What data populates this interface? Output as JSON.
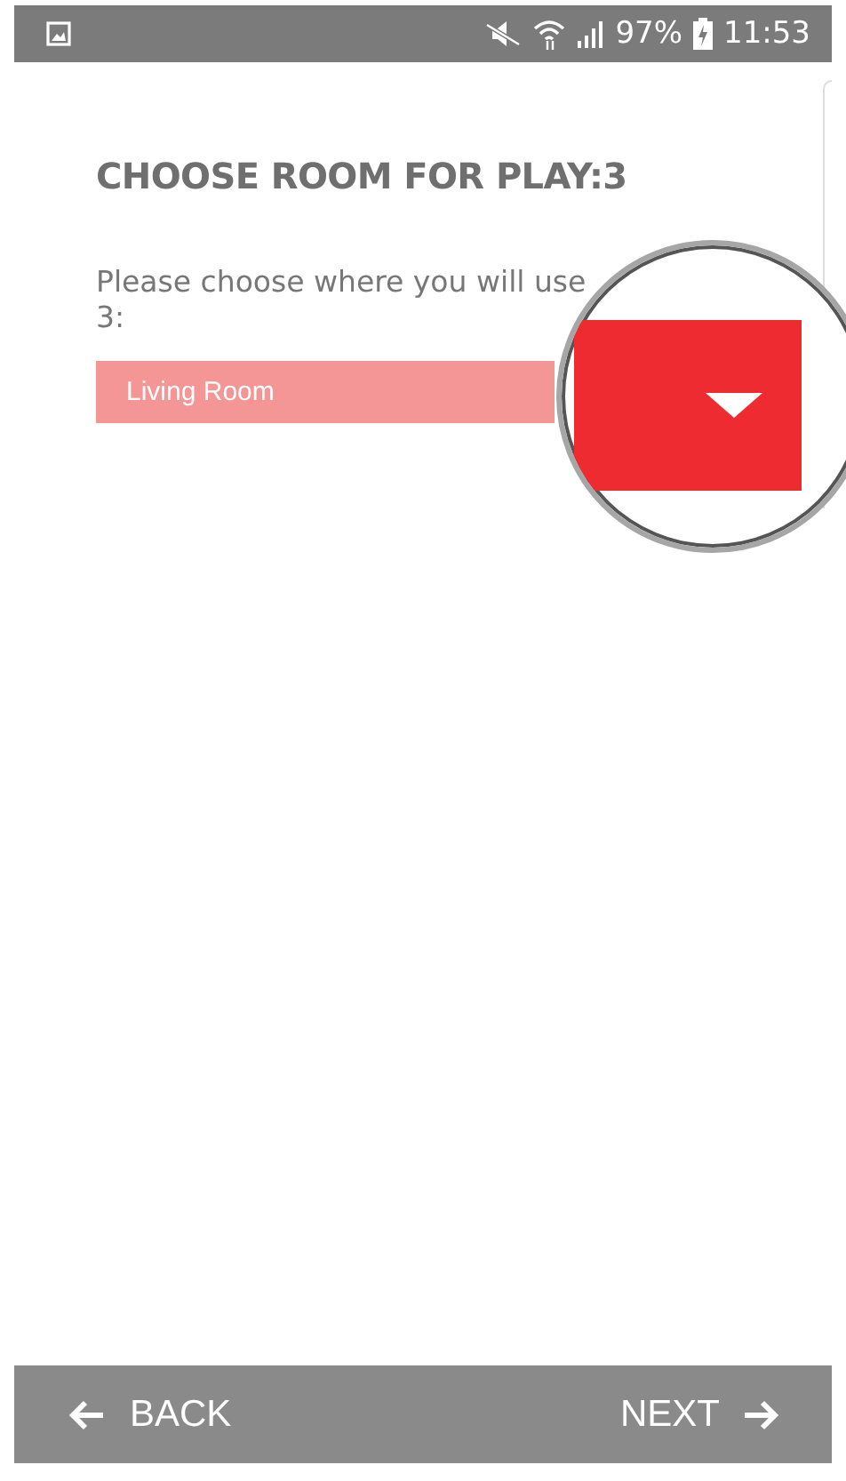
{
  "status_bar": {
    "battery": "97%",
    "time": "11:53"
  },
  "title": "CHOOSE ROOM FOR PLAY:3",
  "prompt_lines": [
    "Please choose where you will use",
    "3:"
  ],
  "room_select": {
    "value": "Living Room"
  },
  "nav": [
    {
      "kind": "back",
      "label": "BACK"
    },
    {
      "kind": "next",
      "label": "NEXT"
    }
  ]
}
